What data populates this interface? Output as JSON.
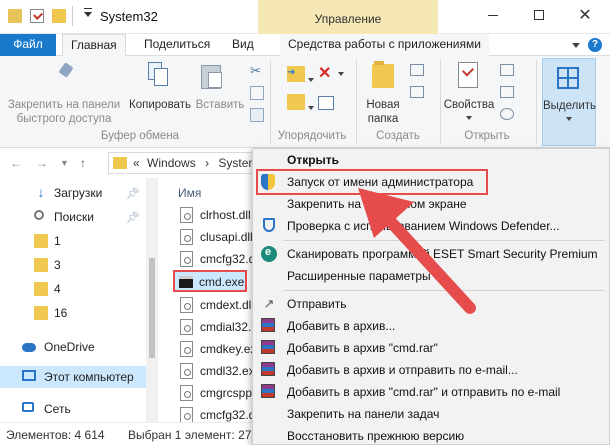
{
  "titlebar": {
    "title": "System32",
    "contextual_tab": "Управление",
    "close_glyph": "✕"
  },
  "tabs": {
    "file": "Файл",
    "home": "Главная",
    "share": "Поделиться",
    "view": "Вид",
    "tools": "Средства работы с приложениями"
  },
  "ribbon": {
    "pin_label_1": "Закрепить на панели",
    "pin_label_2": "быстрого доступа",
    "copy": "Копировать",
    "paste": "Вставить",
    "clipboard_group": "Буфер обмена",
    "organize_group": "Упорядочить",
    "new_folder_1": "Новая",
    "new_folder_2": "папка",
    "create_group": "Создать",
    "properties": "Свойства",
    "open_group": "Открыть",
    "select": "Выделить"
  },
  "address": {
    "prefix": "«",
    "path_1": "Windows",
    "sep": "›",
    "path_2": "Syster"
  },
  "navpane": {
    "items": [
      {
        "label": "Загрузки"
      },
      {
        "label": "Поиски"
      },
      {
        "label": "1"
      },
      {
        "label": "3"
      },
      {
        "label": "4"
      },
      {
        "label": "16"
      },
      {
        "label": "OneDrive"
      },
      {
        "label": "Этот компьютер"
      },
      {
        "label": "Сеть"
      }
    ]
  },
  "files": {
    "column_name": "Имя",
    "rows": [
      {
        "name": "clrhost.dll"
      },
      {
        "name": "clusapi.dll"
      },
      {
        "name": "cmcfg32.dll"
      },
      {
        "name": "cmd.exe"
      },
      {
        "name": "cmdext.dll"
      },
      {
        "name": "cmdial32.dl"
      },
      {
        "name": "cmdkey.exe"
      },
      {
        "name": "cmdl32.exe"
      },
      {
        "name": "cmgrcspp"
      },
      {
        "name": "cmcfg32.d"
      }
    ]
  },
  "status": {
    "items_count": "Элементов: 4 614",
    "selected": "Выбран 1 элемент: 27"
  },
  "context_menu": {
    "items": [
      {
        "label": "Открыть"
      },
      {
        "label": "Запуск от имени администратора"
      },
      {
        "label": "Закрепить на начальном экране"
      },
      {
        "label": "Проверка с использованием Windows Defender..."
      },
      {
        "label": "Сканировать программой ESET Smart Security Premium"
      },
      {
        "label": "Расширенные параметры"
      },
      {
        "label": "Отправить"
      },
      {
        "label": "Добавить в архив..."
      },
      {
        "label": "Добавить в архив \"cmd.rar\""
      },
      {
        "label": "Добавить в архив и отправить по e-mail..."
      },
      {
        "label": "Добавить в архив \"cmd.rar\" и отправить по e-mail"
      },
      {
        "label": "Закрепить на панели задач"
      },
      {
        "label": "Восстановить прежнюю версию"
      }
    ]
  },
  "colors": {
    "accent": "#1979ca",
    "selection": "#cce8ff",
    "highlight_red": "#e74c4c",
    "contextual_tab": "#f5e8b5"
  }
}
